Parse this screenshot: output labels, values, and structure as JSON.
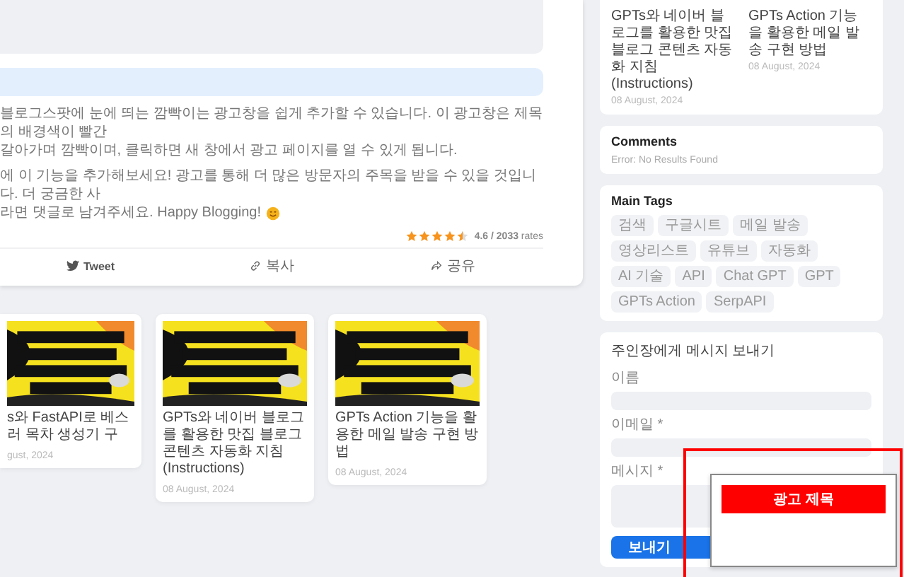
{
  "article": {
    "paragraphs": [
      [
        "블로그스팟에 눈에 띄는 깜빡이는 광고창을 쉽게 추가할 수 있습니다. 이 광고창은 제목의 배경색이 빨간",
        "갈아가며 깜빡이며, 클릭하면 새 창에서 광고 페이지를 열 수 있게 됩니다."
      ],
      [
        "에 이 기능을 추가해보세요! 광고를 통해 더 많은 방문자의 주목을 받을 수 있을 것입니다. 더 궁금한 사",
        "라면 댓글로 남겨주세요. Happy Blogging!"
      ]
    ],
    "rating": {
      "stars": 4.5,
      "text": "**4.6 / 2033** rates"
    },
    "share_buttons": [
      {
        "kind": "tweet",
        "label": "Tweet"
      },
      {
        "kind": "copy",
        "label": "복사"
      },
      {
        "kind": "share",
        "label": "공유"
      }
    ]
  },
  "related_posts": [
    {
      "kind": "clipped",
      "title_lines": [
        "s와 FastAPI로 베스",
        "러 목차 생성기 구"
      ],
      "date": "gust, 2024"
    },
    {
      "kind": "full",
      "title": "GPTs와 네이버 블로그를 활용한 맛집 블로그 콘텐츠 자동화 지침 (Instructions)",
      "date": "08 August, 2024"
    },
    {
      "kind": "full",
      "title": "GPTs Action 기능을 활용한 메일 발송 구현 방법",
      "date": "08 August, 2024"
    }
  ],
  "sidebar": {
    "recent_posts": [
      {
        "title": "GPTs와 네이버 블로그를 활용한 맛집 블로그 콘텐츠 자동화 지침 (Instructions)",
        "date": "08 August, 2024"
      },
      {
        "title": "GPTs Action 기능을 활용한 메일 발송 구현 방법",
        "date": "08 August, 2024"
      }
    ],
    "comments": {
      "title": "Comments",
      "message": "Error: No Results Found"
    },
    "tags": {
      "title": "Main Tags",
      "items": [
        "검색",
        "구글시트",
        "메일 발송",
        "영상리스트",
        "유튜브",
        "자동화",
        "AI 기술",
        "API",
        "Chat GPT",
        "GPT",
        "GPTs Action",
        "SerpAPI"
      ]
    },
    "contact_form": {
      "title": "주인장에게 메시지 보내기",
      "fields": [
        {
          "kind": "input",
          "label": "이름"
        },
        {
          "kind": "input",
          "label": "이메일 *"
        },
        {
          "kind": "textarea",
          "label": "메시지 *"
        }
      ],
      "submit": "보내기"
    }
  },
  "ad_popup": {
    "button": "광고 제목"
  }
}
